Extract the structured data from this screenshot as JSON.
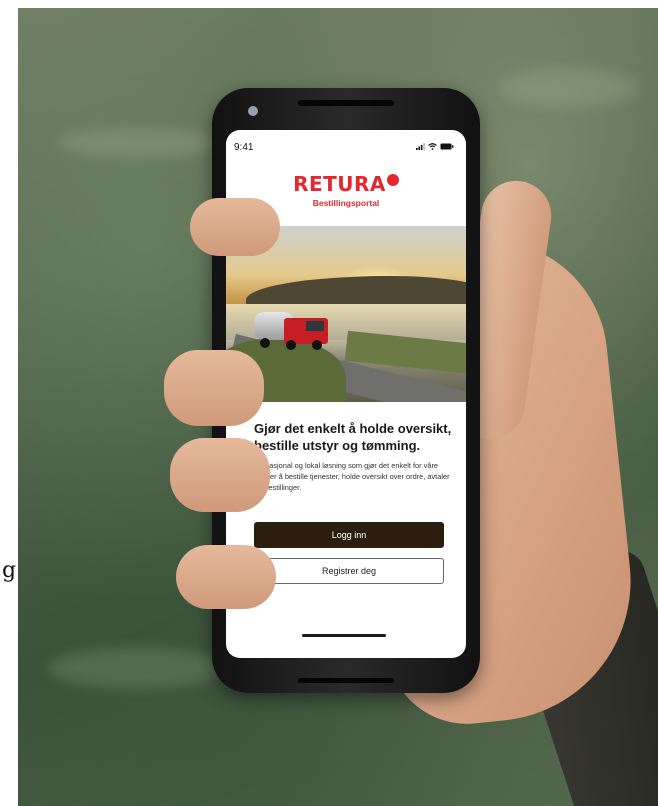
{
  "status_bar": {
    "time": "9:41"
  },
  "logo": {
    "wordmark": "RETURA",
    "subtitle": "Bestillingsportal"
  },
  "headline": "Gjør det enkelt å holde oversikt, bestille utstyr og tømming.",
  "description": "En nasjonal og lokal løsning som gjør det enkelt for våre kunder å bestille tjenester, holde oversikt over ordre, avtaler og bestillinger.",
  "buttons": {
    "login_label": "Logg inn",
    "register_label": "Registrer deg"
  },
  "stray_text": "g",
  "colors": {
    "brand_red": "#e2282e",
    "primary_button": "#2b1e0e"
  },
  "icons": [
    "signal-icon",
    "wifi-icon",
    "battery-icon"
  ]
}
